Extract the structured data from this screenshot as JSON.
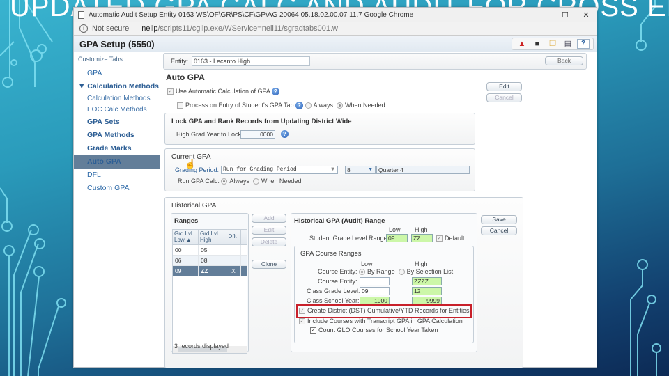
{
  "slide": {
    "title": "UPDATED GPA CALC AND AUDIT FOR CROSS ENTITY"
  },
  "browser": {
    "window_title": "Automatic Audit Setup   Entity 0163   WS\\OF\\GR\\PS\\CF\\GP\\AG   20064   05.18.02.00.07   11.7   Google Chrome",
    "maximize_glyph": "☐",
    "close_glyph": "✕",
    "security_label": "Not secure",
    "url_host": "neilp",
    "url_path": "/scripts11/cgiip.exe/WService=neil11/sgradtabs001.w"
  },
  "app": {
    "title": "GPA Setup (5550)",
    "toolbar_icons": [
      "report-icon",
      "camera-icon",
      "copy-icon",
      "print-icon",
      "help-icon"
    ],
    "help_glyph": "?"
  },
  "sidebar": {
    "header": "Customize Tabs",
    "items": [
      {
        "label": "GPA"
      },
      {
        "label": "▼ Calculation Methods"
      },
      {
        "label": "Calculation Methods"
      },
      {
        "label": "EOC Calc Methods"
      },
      {
        "label": "GPA Sets"
      },
      {
        "label": "GPA Methods"
      },
      {
        "label": "Grade Marks"
      },
      {
        "label": "Auto GPA"
      },
      {
        "label": "DFL"
      },
      {
        "label": "Custom GPA"
      }
    ],
    "active_item": "Auto GPA"
  },
  "entity": {
    "label": "Entity:",
    "value": "0163 - Lecanto High",
    "back_label": "Back"
  },
  "auto_gpa": {
    "heading": "Auto GPA",
    "use_auto_calc_label": "Use Automatic Calculation of GPA",
    "use_auto_calc_checked": true,
    "process_on_entry_label": "Process on Entry of Student's GPA Tab",
    "process_on_entry_checked": false,
    "always_label": "Always",
    "when_needed_label": "When Needed",
    "selected_process_option": "When Needed",
    "edit_label": "Edit",
    "cancel_label": "Cancel"
  },
  "lock_panel": {
    "title": "Lock GPA and Rank Records from Updating District Wide",
    "high_grad_year_label": "High Grad Year to Lock:",
    "high_grad_year_value": "0000"
  },
  "current_gpa": {
    "title": "Current GPA",
    "grading_period_label": "Grading Period:",
    "grading_period_value": "Run for Grading Period",
    "period_number": "8",
    "period_name": "Quarter 4",
    "run_calc_label": "Run GPA Calc:",
    "always_label": "Always",
    "when_needed_label": "When Needed",
    "selected_run_option": "Always"
  },
  "historical_gpa": {
    "title": "Historical GPA",
    "ranges": {
      "title": "Ranges",
      "columns": [
        "Grd Lvl Low ▲",
        "Grd Lvl High",
        "Dflt"
      ],
      "rows": [
        {
          "low": "00",
          "high": "05",
          "dflt": ""
        },
        {
          "low": "06",
          "high": "08",
          "dflt": ""
        },
        {
          "low": "09",
          "high": "ZZ",
          "dflt": "X"
        }
      ],
      "selected_row": 2,
      "records_text": "3 records displayed"
    },
    "buttons": {
      "add": "Add",
      "edit": "Edit",
      "delete": "Delete",
      "clone": "Clone",
      "save": "Save",
      "cancel": "Cancel"
    },
    "audit_range": {
      "title": "Historical GPA (Audit) Range",
      "low_label": "Low",
      "high_label": "High",
      "grade_level_label": "Student Grade Level Range:",
      "grade_low": "09",
      "grade_high": "ZZ",
      "default_label": "Default",
      "default_checked": true
    },
    "course_ranges": {
      "title": "GPA Course Ranges",
      "low_label": "Low",
      "high_label": "High",
      "course_entity_mode_label": "Course Entity:",
      "by_range_label": "By Range",
      "by_selection_label": "By Selection List",
      "selected_mode": "By Range",
      "course_entity_label": "Course Entity:",
      "course_entity_low": "",
      "course_entity_high": "ZZZZ",
      "class_grade_level_label": "Class Grade Level:",
      "class_grade_low": "09",
      "class_grade_high": "12",
      "class_school_year_label": "Class School Year:",
      "school_year_low": "1900",
      "school_year_high": "9999",
      "create_district_label": "Create District (DST) Cumulative/YTD Records for Entities",
      "create_district_checked": true,
      "include_courses_label": "Include Courses with Transcript GPA in GPA Calculation",
      "include_courses_checked": true,
      "count_glo_label": "Count GLO Courses for School Year Taken",
      "count_glo_checked": true
    }
  },
  "colors": {
    "highlight_box": "#c8202a",
    "active_sidebar": "#637e99",
    "green_input": "#ccf7a8"
  }
}
